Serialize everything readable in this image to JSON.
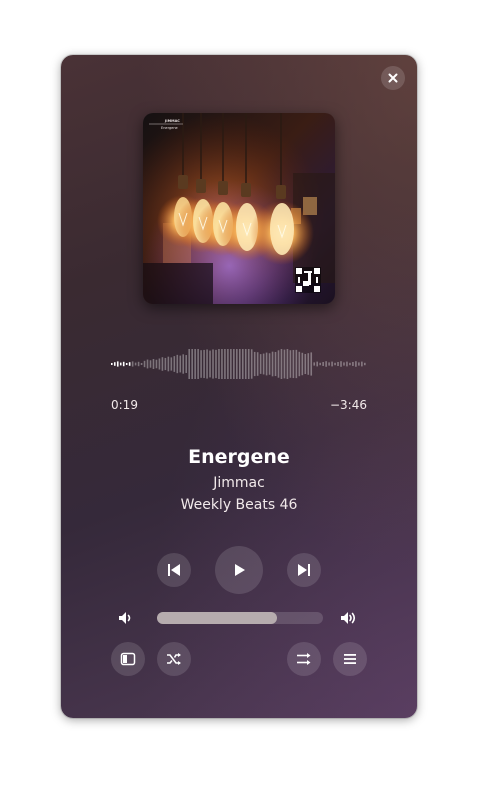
{
  "player": {
    "track_title": "Energene",
    "artist": "Jimmac",
    "album": "Weekly Beats 46",
    "time_elapsed": "0:19",
    "time_remaining": "−3:46",
    "volume_level": 0.72,
    "progress_fraction": 0.077
  },
  "cover": {
    "artist_label": "JIMMAC",
    "title_label": "Energene"
  },
  "icons": {
    "close": "close-icon",
    "previous": "skip-previous-icon",
    "play": "play-icon",
    "next": "skip-next-icon",
    "volume_low": "volume-low-icon",
    "volume_high": "volume-high-icon",
    "sidebar": "sidebar-icon",
    "shuffle": "shuffle-icon",
    "repeat": "repeat-icon",
    "menu": "menu-icon"
  },
  "colors": {
    "text": "#ffffff",
    "button_bg": "rgba(255,255,255,0.13)",
    "volume_fill": "#b6acae"
  }
}
